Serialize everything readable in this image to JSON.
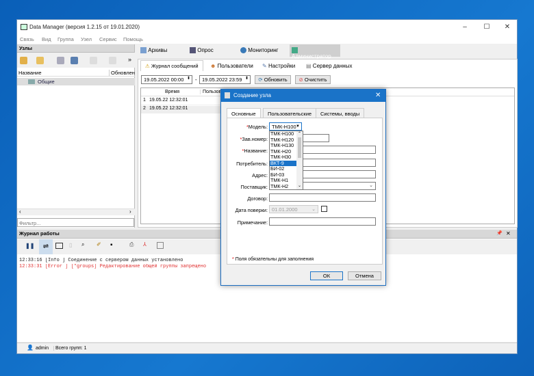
{
  "window": {
    "title": "Data Manager (версия 1.2.15 от 19.01.2020)",
    "minimize": "–",
    "maximize": "☐",
    "close": "✕"
  },
  "menu": [
    "Связь",
    "Вид",
    "Группа",
    "Узел",
    "Сервис",
    "Помощь"
  ],
  "left_panel": {
    "title": "Узлы",
    "more": "»",
    "columns": [
      "Название",
      "Обновлен"
    ],
    "items": [
      {
        "label": "Общие"
      }
    ],
    "filter_placeholder": "Фильтр..."
  },
  "main_tabs": [
    {
      "label": "Архивы"
    },
    {
      "label": "Опрос"
    },
    {
      "label": "Мониторинг"
    },
    {
      "label": "Администратор",
      "active": true
    }
  ],
  "sub_tabs": [
    {
      "label": "Журнал сообщений",
      "active": true
    },
    {
      "label": "Пользователи"
    },
    {
      "label": "Настройки"
    },
    {
      "label": "Сервер данных"
    }
  ],
  "filter": {
    "from": "19.05.2022 00:00",
    "dash": "-",
    "to": "19.05.2022 23:59",
    "refresh": "Обновить",
    "clear": "Очистить"
  },
  "grid": {
    "columns": [
      "Время",
      "Пользова"
    ],
    "rows": [
      {
        "n": "1",
        "time": "19.05.22 12:32:01"
      },
      {
        "n": "2",
        "time": "19.05.22 12:32:01"
      }
    ]
  },
  "journal": {
    "title": "Журнал работы",
    "pin": "📌",
    "close": "✕",
    "lines": [
      {
        "text": "12:33:16 [Info    ] Соединение с сервером данных установлено",
        "color": "#222"
      },
      {
        "text": "12:33:31 [Error   ] [*groups] Редактирование общей группы запрещено",
        "color": "#e03030"
      }
    ]
  },
  "status": {
    "user": "admin",
    "groups": "Всего групп: 1"
  },
  "dialog": {
    "title": "Создание узла",
    "close": "✕",
    "tabs": [
      {
        "label": "Основные",
        "active": true
      },
      {
        "label": "Пользовательские"
      },
      {
        "label": "Системы, вводы"
      }
    ],
    "fields": {
      "model": "Модель:",
      "serial": "Зав.номер:",
      "name": "Название:",
      "consumer": "Потребитель:",
      "address": "Адрес:",
      "supplier": "Поставщик:",
      "contract": "Договор:",
      "verify": "Дата поверки:",
      "note": "Примечание:"
    },
    "model_value": "ТМК-Н100",
    "verify_value": "01.01.2000",
    "required_mark": "*",
    "dropdown": [
      "ТМК-Н100",
      "ТМК-Н120",
      "ТМК-Н130",
      "ТМК-Н20",
      "ТМК-Н30",
      "ВКТ-9",
      "БИ-02",
      "БИ-03",
      "ТМК-Н1",
      "ТМК-Н2"
    ],
    "dropdown_selected": 5,
    "required_note": "Поля обязательны для заполнения",
    "ok": "ОК",
    "cancel": "Отмена"
  }
}
